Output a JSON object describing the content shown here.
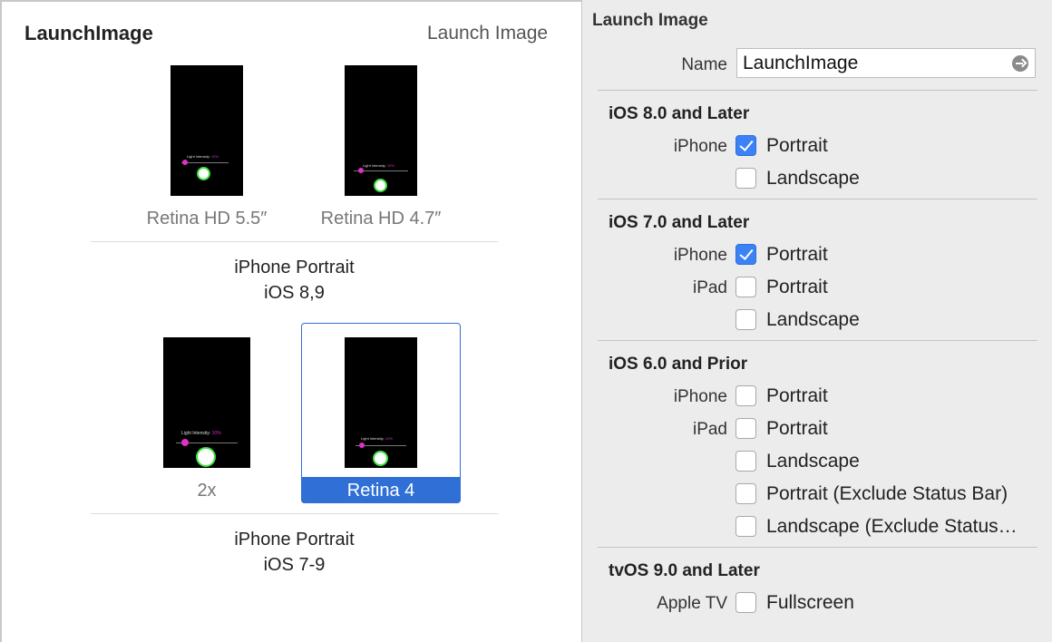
{
  "left": {
    "title": "LaunchImage",
    "subtitle": "Launch Image",
    "thumb_text": "Light Intensity:",
    "thumb_pct": "10%",
    "slots": {
      "retina_hd_55": "Retina HD 5.5″",
      "retina_hd_47": "Retina HD 4.7″",
      "x2": "2x",
      "retina_4": "Retina 4"
    },
    "groups": {
      "g1_line1": "iPhone Portrait",
      "g1_line2": "iOS 8,9",
      "g2_line1": "iPhone Portrait",
      "g2_line2": "iOS 7-9"
    }
  },
  "inspector": {
    "title": "Launch Image",
    "name_label": "Name",
    "name_value": "LaunchImage",
    "sections": {
      "ios8": {
        "title": "iOS 8.0 and Later",
        "iphone_label": "iPhone",
        "portrait": "Portrait",
        "landscape": "Landscape"
      },
      "ios7": {
        "title": "iOS 7.0 and Later",
        "iphone_label": "iPhone",
        "ipad_label": "iPad",
        "iphone_portrait": "Portrait",
        "ipad_portrait": "Portrait",
        "ipad_landscape": "Landscape"
      },
      "ios6": {
        "title": "iOS 6.0 and Prior",
        "iphone_label": "iPhone",
        "ipad_label": "iPad",
        "iphone_portrait": "Portrait",
        "ipad_portrait": "Portrait",
        "ipad_landscape": "Landscape",
        "portrait_excl": "Portrait (Exclude Status Bar)",
        "landscape_excl": "Landscape (Exclude Status…"
      },
      "tvos": {
        "title": "tvOS 9.0 and Later",
        "appletv_label": "Apple TV",
        "fullscreen": "Fullscreen"
      }
    },
    "checked": {
      "ios8_iphone_portrait": true,
      "ios8_iphone_landscape": false,
      "ios7_iphone_portrait": true,
      "ios7_ipad_portrait": false,
      "ios7_ipad_landscape": false,
      "ios6_iphone_portrait": false,
      "ios6_ipad_portrait": false,
      "ios6_ipad_landscape": false,
      "ios6_portrait_excl": false,
      "ios6_landscape_excl": false,
      "tvos_fullscreen": false
    }
  },
  "colors": {
    "accent": "#2f6fd6",
    "slider_knob": "#e030c8",
    "ring": "#3fe03f"
  }
}
